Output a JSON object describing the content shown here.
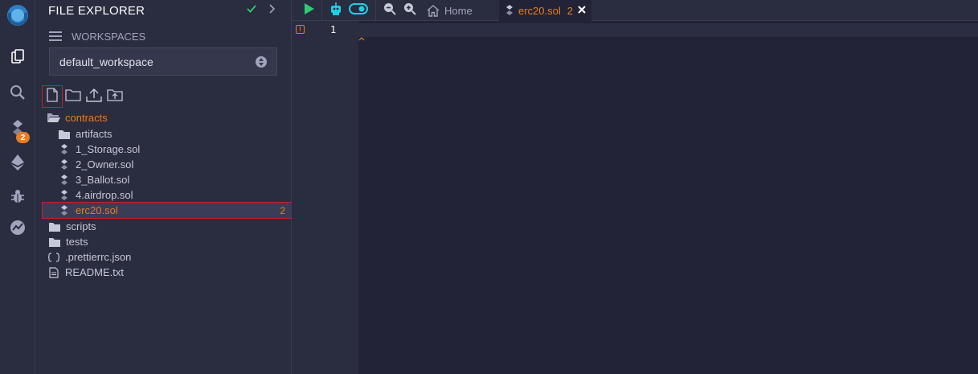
{
  "panel": {
    "title": "FILE EXPLORER",
    "workspaces_label": "WORKSPACES",
    "workspace_selected": "default_workspace"
  },
  "rail": {
    "icons": [
      "remix-logo-icon",
      "file-explorer-icon",
      "search-icon",
      "solidity-compiler-icon",
      "deploy-run-icon",
      "debugger-icon",
      "analytics-icon"
    ],
    "compiler_badge": "2"
  },
  "tree": {
    "contracts": "contracts",
    "artifacts": "artifacts",
    "storage": "1_Storage.sol",
    "owner": "2_Owner.sol",
    "ballot": "3_Ballot.sol",
    "airdrop": "4.airdrop.sol",
    "erc20": "erc20.sol",
    "erc20_count": "2",
    "scripts": "scripts",
    "tests": "tests",
    "prettier": ".prettierrc.json",
    "readme": "README.txt"
  },
  "tabs": {
    "home": "Home",
    "file": "erc20.sol",
    "file_count": "2"
  },
  "editor": {
    "line_number": "1",
    "warning_marker": "!"
  },
  "colors": {
    "accent": "#e67e22",
    "highlight_border": "#c0232b",
    "run_green": "#2ecc71",
    "toggle_cyan": "#1bd2e6"
  }
}
